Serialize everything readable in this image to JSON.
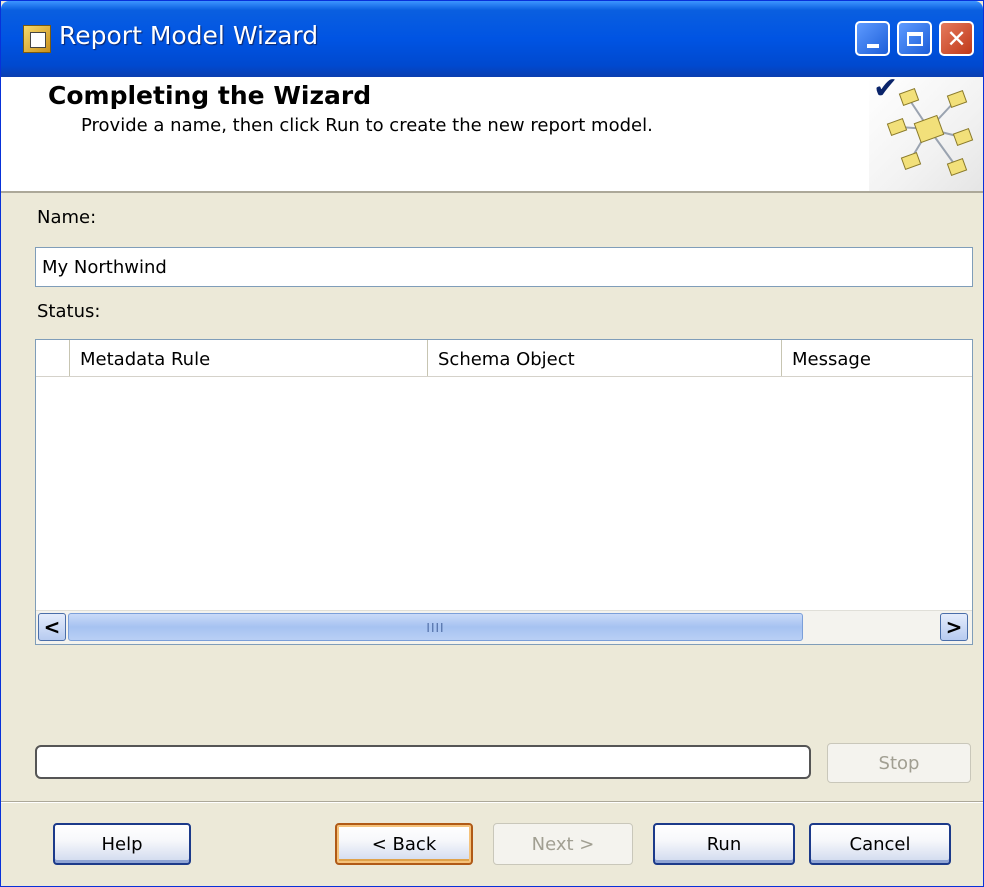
{
  "window": {
    "title": "Report Model Wizard",
    "minimize_symbol": "_",
    "close_symbol": "✕"
  },
  "banner": {
    "title": "Completing the Wizard",
    "subtitle": "Provide a name, then click Run to create the new report model.",
    "check_symbol": "✔"
  },
  "form": {
    "name_label": "Name:",
    "name_value": "My Northwind",
    "status_label": "Status:"
  },
  "status_table": {
    "columns": [
      "Metadata Rule",
      "Schema Object",
      "Message"
    ],
    "rows": [],
    "scroll_left": "<",
    "scroll_right": ">",
    "thumb_grip": "IIII"
  },
  "progress": {
    "value_percent": 0
  },
  "buttons": {
    "stop": "Stop",
    "help": "Help",
    "back": "< Back",
    "next": "Next >",
    "run": "Run",
    "cancel": "Cancel"
  },
  "colors": {
    "titlebar": "#0054e3",
    "dialog_face": "#ece9d8",
    "focus_border": "#b05a17"
  }
}
